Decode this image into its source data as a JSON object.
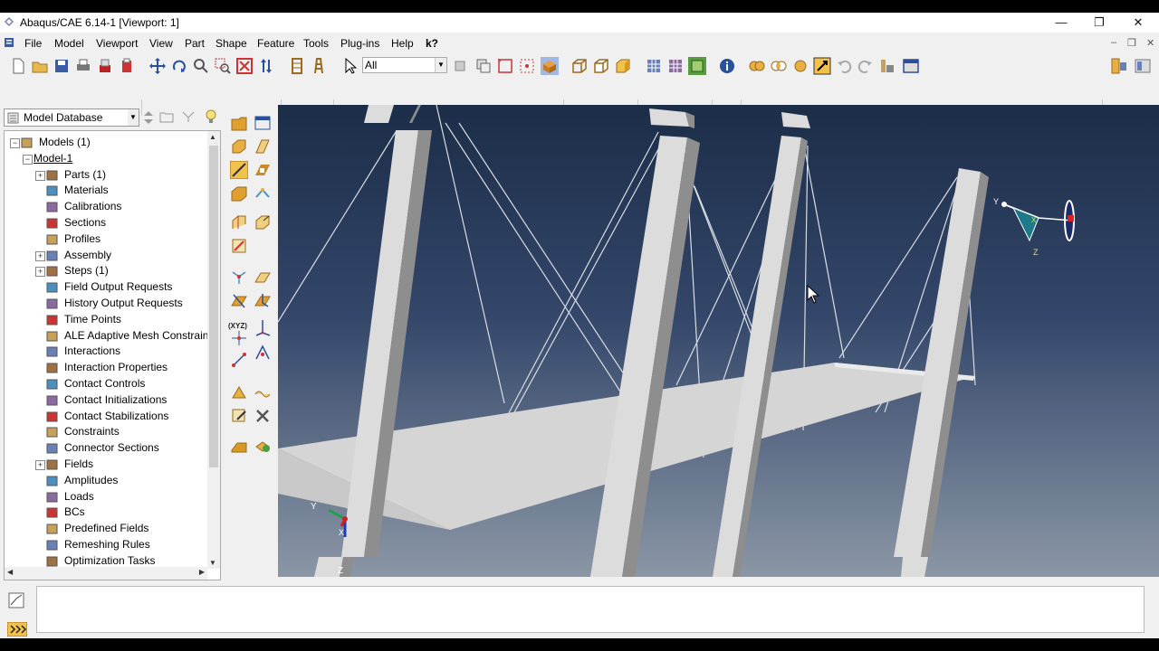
{
  "window": {
    "title": "Abaqus/CAE 6.14-1 [Viewport: 1]",
    "controls": {
      "minimize": "—",
      "restore": "❐",
      "close": "✕"
    }
  },
  "menubar": {
    "items": [
      "File",
      "Model",
      "Viewport",
      "View",
      "Part",
      "Shape",
      "Feature",
      "Tools",
      "Plug-ins",
      "Help"
    ],
    "context_help": "k?",
    "mdi": {
      "minimize": "–",
      "restore": "❐",
      "close": "✕"
    }
  },
  "toolbar": {
    "selection_filter": "All"
  },
  "model_tree": {
    "selector": "Model Database",
    "items": [
      {
        "label": "Models (1)",
        "level": 0,
        "expander": "−",
        "icon": "models-icon"
      },
      {
        "label": "Model-1",
        "level": 1,
        "expander": "−",
        "icon": ""
      },
      {
        "label": "Parts (1)",
        "level": 2,
        "expander": "+",
        "icon": "parts-icon"
      },
      {
        "label": "Materials",
        "level": 2,
        "expander": "",
        "icon": "materials-icon"
      },
      {
        "label": "Calibrations",
        "level": 2,
        "expander": "",
        "icon": "calibrations-icon"
      },
      {
        "label": "Sections",
        "level": 2,
        "expander": "",
        "icon": "sections-icon"
      },
      {
        "label": "Profiles",
        "level": 2,
        "expander": "",
        "icon": "profiles-icon"
      },
      {
        "label": "Assembly",
        "level": 2,
        "expander": "+",
        "icon": "assembly-icon"
      },
      {
        "label": "Steps (1)",
        "level": 2,
        "expander": "+",
        "icon": "steps-icon"
      },
      {
        "label": "Field Output Requests",
        "level": 2,
        "expander": "",
        "icon": "field-output-icon"
      },
      {
        "label": "History Output Requests",
        "level": 2,
        "expander": "",
        "icon": "history-output-icon"
      },
      {
        "label": "Time Points",
        "level": 2,
        "expander": "",
        "icon": "time-points-icon"
      },
      {
        "label": "ALE Adaptive Mesh Constraints",
        "level": 2,
        "expander": "",
        "icon": "ale-icon"
      },
      {
        "label": "Interactions",
        "level": 2,
        "expander": "",
        "icon": "interactions-icon"
      },
      {
        "label": "Interaction Properties",
        "level": 2,
        "expander": "",
        "icon": "interaction-properties-icon"
      },
      {
        "label": "Contact Controls",
        "level": 2,
        "expander": "",
        "icon": "contact-controls-icon"
      },
      {
        "label": "Contact Initializations",
        "level": 2,
        "expander": "",
        "icon": "contact-initializations-icon"
      },
      {
        "label": "Contact Stabilizations",
        "level": 2,
        "expander": "",
        "icon": "contact-stabilizations-icon"
      },
      {
        "label": "Constraints",
        "level": 2,
        "expander": "",
        "icon": "constraints-icon"
      },
      {
        "label": "Connector Sections",
        "level": 2,
        "expander": "",
        "icon": "connector-sections-icon"
      },
      {
        "label": "Fields",
        "level": 2,
        "expander": "+",
        "icon": "fields-icon"
      },
      {
        "label": "Amplitudes",
        "level": 2,
        "expander": "",
        "icon": "amplitudes-icon"
      },
      {
        "label": "Loads",
        "level": 2,
        "expander": "",
        "icon": "loads-icon"
      },
      {
        "label": "BCs",
        "level": 2,
        "expander": "",
        "icon": "bcs-icon"
      },
      {
        "label": "Predefined Fields",
        "level": 2,
        "expander": "",
        "icon": "predefined-fields-icon"
      },
      {
        "label": "Remeshing Rules",
        "level": 2,
        "expander": "",
        "icon": "remeshing-rules-icon"
      },
      {
        "label": "Optimization Tasks",
        "level": 2,
        "expander": "",
        "icon": "optimization-tasks-icon"
      }
    ]
  },
  "toolbox": {
    "xyz_label": "(XYZ)"
  },
  "viewport": {
    "triad_labels": {
      "y": "Y",
      "x": "X",
      "z": "Z"
    },
    "rp_labels": {
      "y": "Y",
      "x": "X",
      "z": "Z"
    }
  },
  "colors": {
    "viewport_top": "#1c2d48",
    "viewport_bottom": "#8b97a6",
    "part_face": "#dcdcdc",
    "part_shade": "#8e8e8e"
  }
}
